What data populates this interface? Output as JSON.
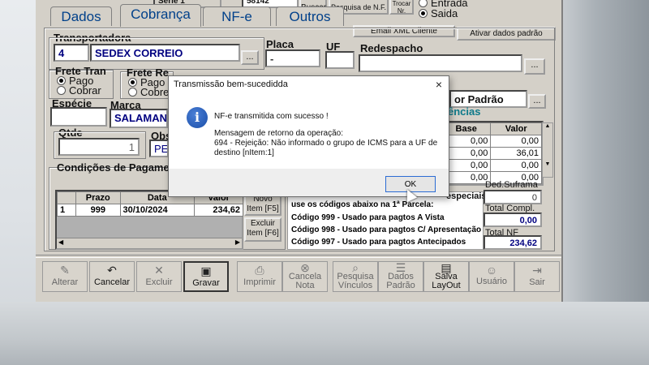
{
  "top": {
    "serie_label": "Serie 1",
    "number": "58142",
    "buscar": "Buscar",
    "pesquisa_nf": "Pesquisa de N.F.",
    "trocar": "Trocar Nr.",
    "entrada": "Entrada",
    "saida": "Saida"
  },
  "tabs": [
    "Dados",
    "Cobrança",
    "NF-e",
    "Outros"
  ],
  "buttons": {
    "email_xml": "Email XML Cliente",
    "ativar": "Ativar dados padrão"
  },
  "transportadora": {
    "label": "Transportadora",
    "code": "4",
    "name": "SEDEX CORREIO",
    "ellipsis": "...",
    "placa_label": "Placa",
    "placa_value": "-",
    "uf_label": "UF",
    "redespacho_label": "Redespacho"
  },
  "frete_tran": {
    "label": "Frete Tran",
    "opt1": "Pago",
    "opt2": "Cobrar"
  },
  "frete_red": {
    "label": "Frete Re",
    "opt1": "Pago",
    "opt2": "Cobre"
  },
  "especie_label": "Espécie",
  "marca_label": "Marca",
  "marca_value": "SALAMAN",
  "padrao_value": "or Padrão",
  "qtde_label": "Qtde",
  "qtde_value": "1",
  "obs_label": "Obs",
  "obs_value": "PEI",
  "referencias_label": "ências",
  "ref_grid": {
    "headers": [
      "Base",
      "Valor"
    ],
    "rows": [
      [
        "0,00",
        "0,00"
      ],
      [
        "0,00",
        "36,01"
      ],
      [
        "0,00",
        "0,00"
      ],
      [
        "0,00",
        "0,00"
      ]
    ]
  },
  "condicoes": {
    "label": "Condições de Pagame",
    "headers": [
      "Prazo",
      "Data",
      "Valor"
    ],
    "row": {
      "n": "1",
      "prazo": "999",
      "data": "30/10/2024",
      "valor": "234,62"
    },
    "novo_item": "Novo Item [F5]",
    "excluir_item": "Excluir Item [F6]"
  },
  "codigos": {
    "header": "use os códigos abaixo na 1ª Parcela:",
    "especiais": "especiais",
    "lines": [
      "Código 999 - Usado para pagtos A Vista",
      "Código 998 - Usado para pagtos C/ Apresentação",
      "Código 997 - Usado para pagtos Antecipados"
    ]
  },
  "totals": {
    "ded_suframa_label": "Ded.Suframa",
    "ded_suframa_value": "0",
    "total_compl_label": "Total Compl.",
    "total_compl_value": "0,00",
    "total_nf_label": "Total NF",
    "total_nf_value": "234,62"
  },
  "toolbar": [
    {
      "label": "Alterar",
      "icon": "edit-icon"
    },
    {
      "label": "Cancelar",
      "icon": "undo-icon"
    },
    {
      "label": "Excluir",
      "icon": "x-icon"
    },
    {
      "label": "Gravar",
      "icon": "save-icon"
    },
    {
      "label": "Imprimir",
      "icon": "printer-icon"
    },
    {
      "label": "Cancela Nota",
      "icon": "cancel-circle-icon"
    },
    {
      "label": "Pesquisa Vínculos",
      "icon": "search-links-icon"
    },
    {
      "label": "Dados Padrão",
      "icon": "defaults-icon"
    },
    {
      "label": "Salva LayOut",
      "icon": "save-layout-icon"
    },
    {
      "label": "Usuário",
      "icon": "user-icon"
    },
    {
      "label": "Sair",
      "icon": "exit-icon"
    }
  ],
  "dialog": {
    "title": "Transmissão bem-sucedidda",
    "line1": "NF-e transmitida com sucesso !",
    "line2": "Mensagem de retorno da operação:",
    "line3": "694 - Rejeição: Não informado o grupo de ICMS para a UF de destino [nItem:1]",
    "ok": "OK",
    "close": "×"
  }
}
